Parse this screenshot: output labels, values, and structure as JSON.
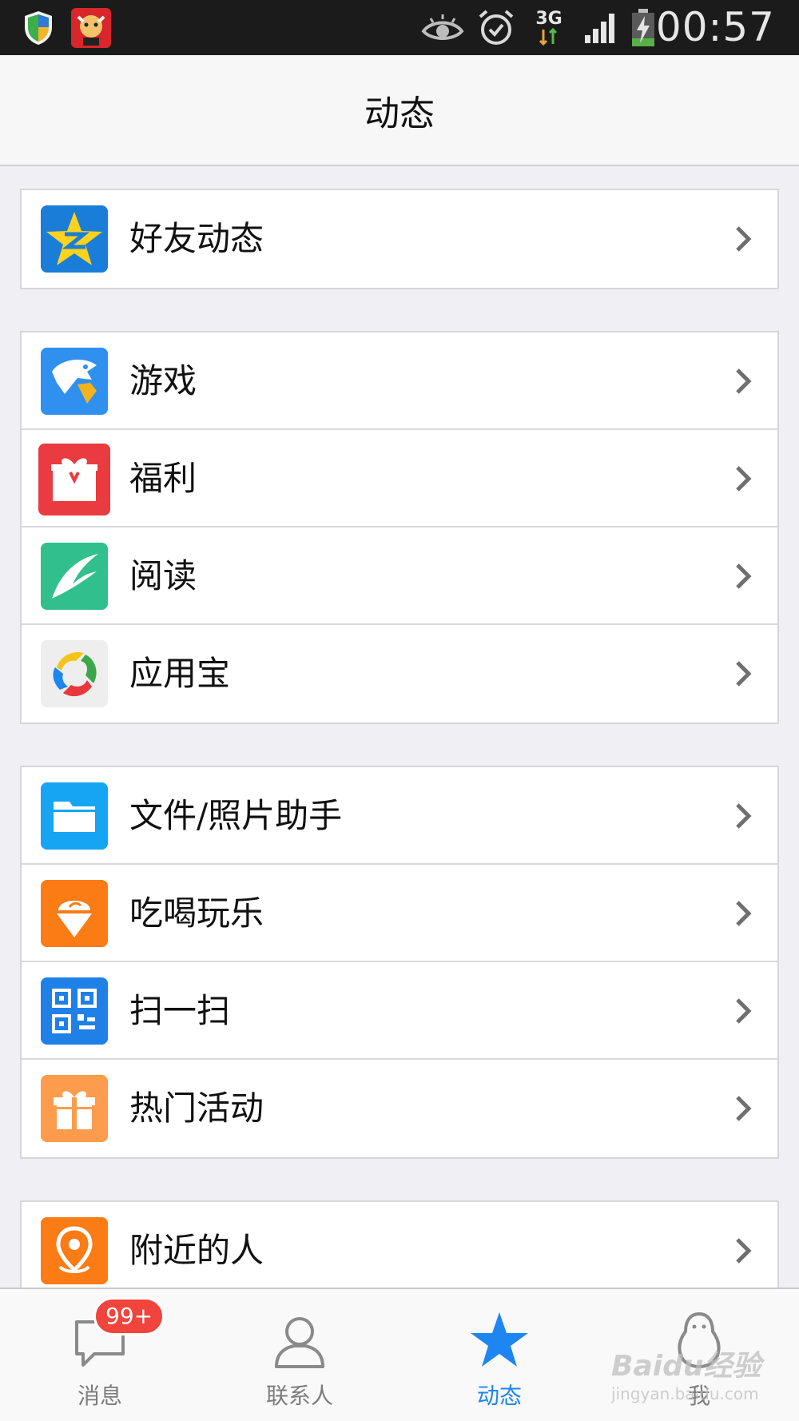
{
  "status_bar": {
    "time": "00:57",
    "network": "3G",
    "icons": [
      "shield-icon",
      "app-notification-icon",
      "eye-icon",
      "alarm-icon",
      "network-3g-icon",
      "signal-icon",
      "battery-charging-icon"
    ]
  },
  "header": {
    "title": "动态"
  },
  "groups": [
    {
      "items": [
        {
          "label": "好友动态",
          "icon": "qzone-star-icon"
        }
      ]
    },
    {
      "items": [
        {
          "label": "游戏",
          "icon": "game-icon"
        },
        {
          "label": "福利",
          "icon": "gift-icon"
        },
        {
          "label": "阅读",
          "icon": "reading-icon"
        },
        {
          "label": "应用宝",
          "icon": "app-store-icon"
        }
      ]
    },
    {
      "items": [
        {
          "label": "文件/照片助手",
          "icon": "folder-icon"
        },
        {
          "label": "吃喝玩乐",
          "icon": "ice-cream-icon"
        },
        {
          "label": "扫一扫",
          "icon": "qr-code-icon"
        },
        {
          "label": "热门活动",
          "icon": "activity-gift-icon"
        }
      ]
    },
    {
      "items": [
        {
          "label": "附近的人",
          "icon": "location-pin-icon"
        }
      ]
    }
  ],
  "tab_bar": {
    "tabs": [
      {
        "label": "消息",
        "icon": "message-bubble-icon",
        "badge": "99+"
      },
      {
        "label": "联系人",
        "icon": "contact-person-icon"
      },
      {
        "label": "动态",
        "icon": "star-icon",
        "active": true
      },
      {
        "label": "我",
        "icon": "penguin-icon"
      }
    ]
  },
  "watermark": {
    "main": "Baidu经验",
    "sub": "jingyan.baidu.com"
  },
  "colors": {
    "accent": "#1e86f0",
    "badge": "#f0443c",
    "status_bar_bg": "#1b1b1b",
    "page_bg": "#efeff4"
  }
}
